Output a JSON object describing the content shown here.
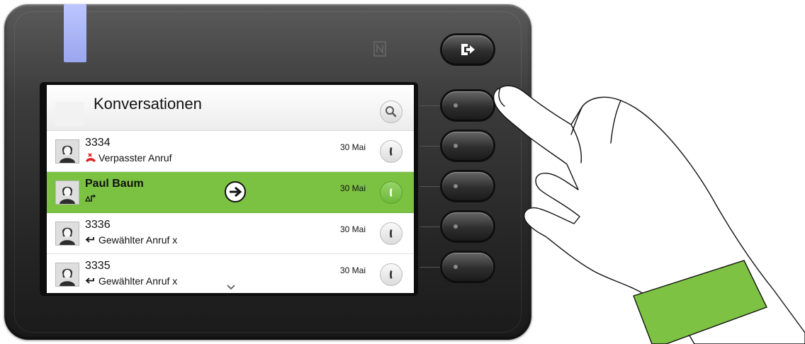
{
  "screen": {
    "title": "Konversationen",
    "conversations": [
      {
        "name": "3334",
        "status": "Verpasster Anruf",
        "status_icon": "missed-call-icon",
        "date": "30 Mai",
        "selected": false
      },
      {
        "name": "Paul Baum",
        "status": "",
        "status_icon": "forwarded-call-icon",
        "date": "30 Mai",
        "selected": true
      },
      {
        "name": "3336",
        "status": "Gewählter Anruf x",
        "status_icon": "dialed-call-icon",
        "date": "30 Mai",
        "selected": false
      },
      {
        "name": "3335",
        "status": "Gewählter Anruf x",
        "status_icon": "dialed-call-icon",
        "date": "30 Mai",
        "selected": false
      }
    ]
  },
  "device": {
    "led_color": "#a9b4f6",
    "selection_color": "#7cc242",
    "missed_color": "#e02020",
    "hand_band_color": "#7dc242"
  },
  "keys": [
    "exit-key",
    "softkey-1",
    "softkey-2",
    "softkey-3",
    "softkey-4",
    "softkey-5"
  ]
}
